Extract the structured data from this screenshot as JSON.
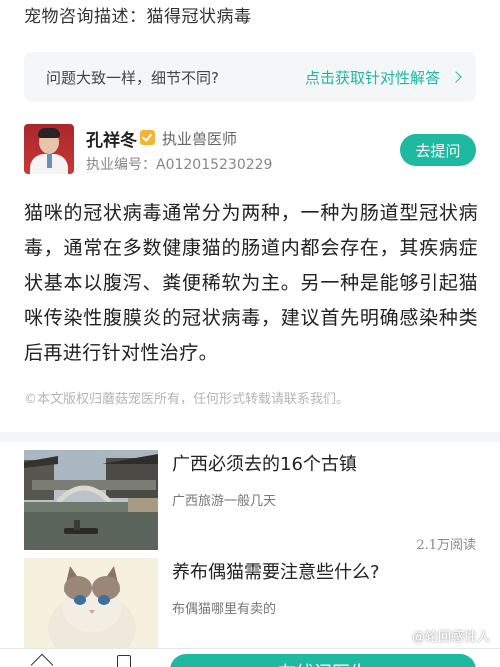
{
  "top": {
    "description": "宠物咨询描述：猫得冠状病毒"
  },
  "help_bar": {
    "question": "问题大致一样，细节不同?",
    "cta": "点击获取针对性解答"
  },
  "doctor": {
    "name": "孔祥冬",
    "title": "执业兽医师",
    "license": "执业编号：A012015230229",
    "ask_label": "去提问"
  },
  "answer": {
    "text": "猫咪的冠状病毒通常分为两种，一种为肠道型冠状病毒，通常在多数健康猫的肠道内都会存在，其疾病症状基本以腹泻、粪便稀软为主。另一种是能够引起猫咪传染性腹膜炎的冠状病毒，建议首先明确感染种类后再进行针对性治疗。"
  },
  "copyright": "©本文版权归蘑菇宠医所有，任何形式转载请联系我们。",
  "articles": [
    {
      "title": "广西必须去的16个古镇",
      "subtitle": "广西旅游一般几天",
      "reads": "2.1万阅读"
    },
    {
      "title": "养布偶猫需要注意些什么?",
      "subtitle": "布偶猫哪里有卖的",
      "reads": ""
    }
  ],
  "bottom": {
    "consult_label": "在线问医生",
    "watermark": "@轮回感性人"
  },
  "colors": {
    "accent": "#1db9a0",
    "badge": "#f2b632"
  }
}
